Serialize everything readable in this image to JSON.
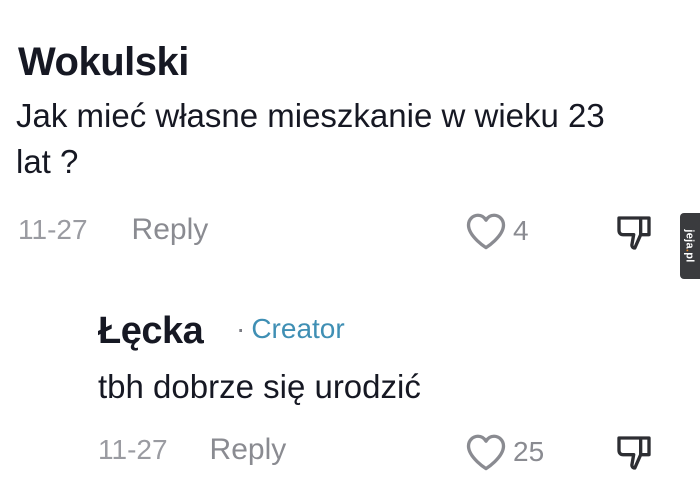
{
  "comments": [
    {
      "username": "Wokulski",
      "text": "Jak mieć własne mieszkanie w wieku 23 lat ?",
      "date": "11-27",
      "reply_label": "Reply",
      "likes": "4",
      "like_icon": "heart-icon",
      "dislike_icon": "thumbs-down-icon"
    },
    {
      "username": "Łęcka",
      "separator": "·",
      "badge": "Creator",
      "text": "tbh dobrze się urodzić",
      "date": "11-27",
      "reply_label": "Reply",
      "likes": "25",
      "like_icon": "heart-icon",
      "dislike_icon": "thumbs-down-icon"
    }
  ],
  "watermark": {
    "brand": "jeja",
    "dot": ".",
    "tld": "pl"
  },
  "colors": {
    "text": "#161823",
    "muted": "#8a8b91",
    "creator": "#3f8fb4",
    "watermark_bg": "#3a3b3e",
    "watermark_accent": "#f08a24"
  }
}
